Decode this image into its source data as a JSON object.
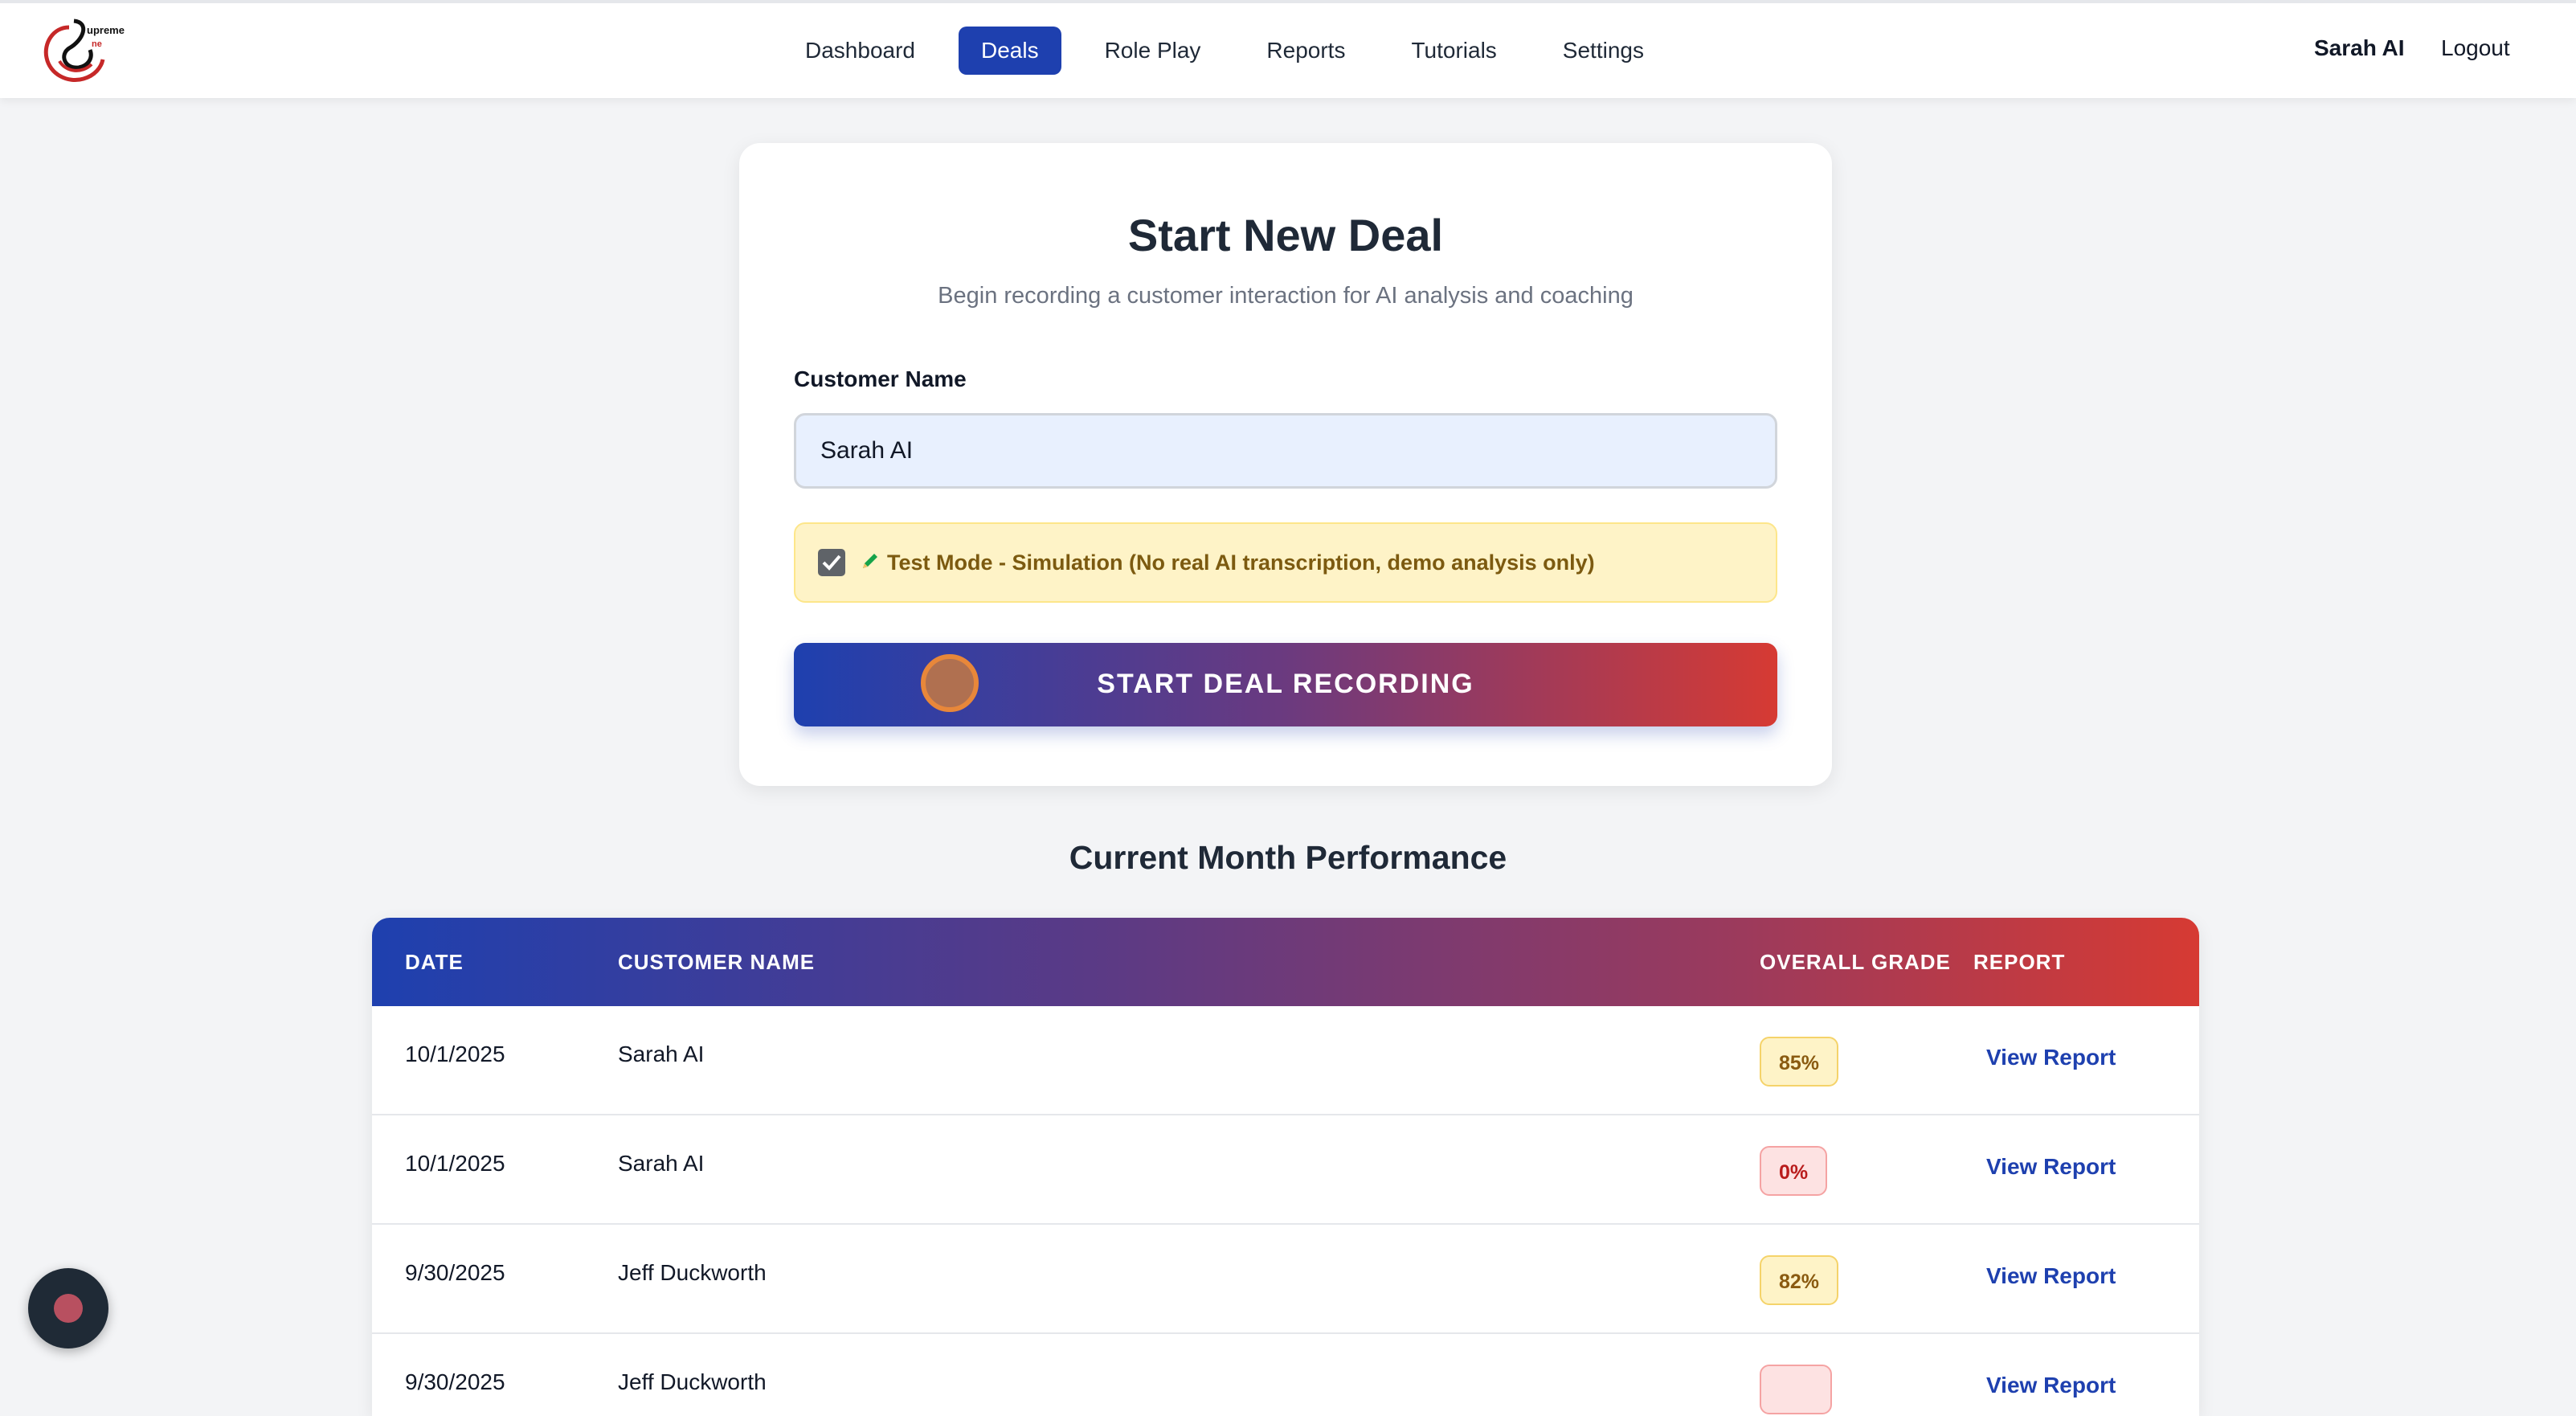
{
  "nav": {
    "logo_text": "Supreme One",
    "items": [
      {
        "label": "Dashboard",
        "active": false
      },
      {
        "label": "Deals",
        "active": true
      },
      {
        "label": "Role Play",
        "active": false
      },
      {
        "label": "Reports",
        "active": false
      },
      {
        "label": "Tutorials",
        "active": false
      },
      {
        "label": "Settings",
        "active": false
      }
    ],
    "user_name": "Sarah AI",
    "logout_label": "Logout"
  },
  "deal_form": {
    "title": "Start New Deal",
    "subtitle": "Begin recording a customer interaction for AI analysis and coaching",
    "customer_name_label": "Customer Name",
    "customer_name_value": "Sarah AI",
    "test_mode_checked": true,
    "test_mode_icon": "pencil-icon",
    "test_mode_label": "Test Mode - Simulation (No real AI transcription, demo analysis only)",
    "start_button_label": "START DEAL RECORDING",
    "start_button_icon": "record-icon"
  },
  "performance": {
    "title": "Current Month Performance",
    "columns": [
      "DATE",
      "CUSTOMER NAME",
      "OVERALL GRADE",
      "REPORT"
    ],
    "rows": [
      {
        "date": "10/1/2025",
        "customer": "Sarah AI",
        "grade": "85%",
        "grade_status": "good",
        "report": "View Report"
      },
      {
        "date": "10/1/2025",
        "customer": "Sarah AI",
        "grade": "0%",
        "grade_status": "bad",
        "report": "View Report"
      },
      {
        "date": "9/30/2025",
        "customer": "Jeff Duckworth",
        "grade": "82%",
        "grade_status": "good",
        "report": "View Report"
      },
      {
        "date": "9/30/2025",
        "customer": "Jeff Duckworth",
        "grade": "",
        "grade_status": "bad",
        "report": "View Report"
      }
    ]
  },
  "colors": {
    "primary": "#1e40af",
    "accent_red": "#d63a33",
    "page_bg": "#f3f4f6",
    "test_mode_bg": "#fef3c7"
  },
  "floating_widget": {
    "icon": "record-dot-icon"
  }
}
